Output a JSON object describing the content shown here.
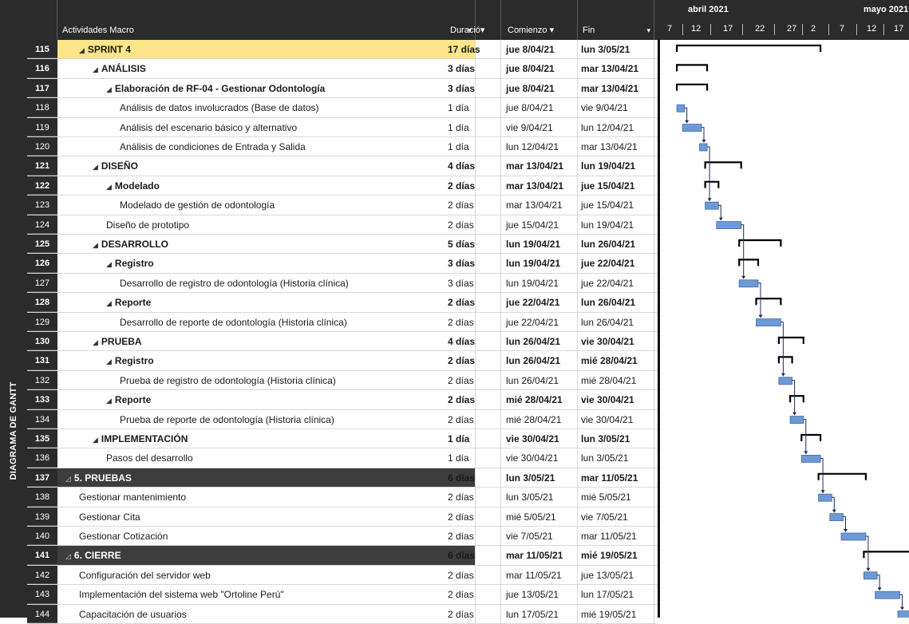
{
  "sidebar": {
    "label": "DIAGRAMA DE GANTT"
  },
  "header": {
    "columns": [
      {
        "label": "Actividades Macro"
      },
      {
        "label": "Duració▾"
      },
      {
        "label": "Comienzo ▾"
      },
      {
        "label": "Fin"
      }
    ],
    "dropdown_glyph": "▾"
  },
  "timescale": {
    "months": [
      "abril 2021",
      "mayo 2021"
    ],
    "days": [
      "7",
      "12",
      "17",
      "22",
      "27",
      "2",
      "7",
      "12",
      "17"
    ]
  },
  "rows": [
    {
      "id": "115",
      "name": "SPRINT 4",
      "dur": "17 días",
      "start": "jue 8/04/21",
      "end": "lun 3/05/21",
      "indent": 1,
      "summary": true,
      "bold": true,
      "selected": true
    },
    {
      "id": "116",
      "name": "ANÁLISIS",
      "dur": "3 días",
      "start": "jue 8/04/21",
      "end": "mar 13/04/21",
      "indent": 2,
      "summary": true,
      "bold": true
    },
    {
      "id": "117",
      "name": "Elaboración de RF-04 - Gestionar Odontología",
      "dur": "3 días",
      "start": "jue 8/04/21",
      "end": "mar 13/04/21",
      "indent": 3,
      "summary": true,
      "bold": true
    },
    {
      "id": "118",
      "name": "Análisis de datos involucrados (Base de datos)",
      "dur": "1 día",
      "start": "jue 8/04/21",
      "end": "vie 9/04/21",
      "indent": 4
    },
    {
      "id": "119",
      "name": "Análisis del escenario básico y alternativo",
      "dur": "1 día",
      "start": "vie 9/04/21",
      "end": "lun 12/04/21",
      "indent": 4
    },
    {
      "id": "120",
      "name": "Análisis de condiciones de Entrada y Salida",
      "dur": "1 día",
      "start": "lun 12/04/21",
      "end": "mar 13/04/21",
      "indent": 4
    },
    {
      "id": "121",
      "name": "DISEÑO",
      "dur": "4 días",
      "start": "mar 13/04/21",
      "end": "lun 19/04/21",
      "indent": 2,
      "summary": true,
      "bold": true
    },
    {
      "id": "122",
      "name": "Modelado",
      "dur": "2 días",
      "start": "mar 13/04/21",
      "end": "jue 15/04/21",
      "indent": 3,
      "summary": true,
      "bold": true
    },
    {
      "id": "123",
      "name": "Modelado de gestión de odontología",
      "dur": "2 días",
      "start": "mar 13/04/21",
      "end": "jue 15/04/21",
      "indent": 4
    },
    {
      "id": "124",
      "name": "Diseño de prototipo",
      "dur": "2 días",
      "start": "jue 15/04/21",
      "end": "lun 19/04/21",
      "indent": 3
    },
    {
      "id": "125",
      "name": "DESARROLLO",
      "dur": "5 días",
      "start": "lun 19/04/21",
      "end": "lun 26/04/21",
      "indent": 2,
      "summary": true,
      "bold": true
    },
    {
      "id": "126",
      "name": "Registro",
      "dur": "3 días",
      "start": "lun 19/04/21",
      "end": "jue 22/04/21",
      "indent": 3,
      "summary": true,
      "bold": true
    },
    {
      "id": "127",
      "name": "Desarrollo de registro de odontología (Historia clínica)",
      "dur": "3 días",
      "start": "lun 19/04/21",
      "end": "jue 22/04/21",
      "indent": 4
    },
    {
      "id": "128",
      "name": "Reporte",
      "dur": "2 días",
      "start": "jue 22/04/21",
      "end": "lun 26/04/21",
      "indent": 3,
      "summary": true,
      "bold": true
    },
    {
      "id": "129",
      "name": "Desarrollo de reporte de odontología (Historia clínica)",
      "dur": "2 días",
      "start": "jue 22/04/21",
      "end": "lun 26/04/21",
      "indent": 4
    },
    {
      "id": "130",
      "name": "PRUEBA",
      "dur": "4 días",
      "start": "lun 26/04/21",
      "end": "vie 30/04/21",
      "indent": 2,
      "summary": true,
      "bold": true
    },
    {
      "id": "131",
      "name": "Registro",
      "dur": "2 días",
      "start": "lun 26/04/21",
      "end": "mié 28/04/21",
      "indent": 3,
      "summary": true,
      "bold": true
    },
    {
      "id": "132",
      "name": "Prueba de registro de odontología (Historia clínica)",
      "dur": "2 días",
      "start": "lun 26/04/21",
      "end": "mié 28/04/21",
      "indent": 4
    },
    {
      "id": "133",
      "name": "Reporte",
      "dur": "2 días",
      "start": "mié 28/04/21",
      "end": "vie 30/04/21",
      "indent": 3,
      "summary": true,
      "bold": true
    },
    {
      "id": "134",
      "name": "Prueba de reporte de odontología (Historia clínica)",
      "dur": "2 días",
      "start": "mié 28/04/21",
      "end": "vie 30/04/21",
      "indent": 4
    },
    {
      "id": "135",
      "name": "IMPLEMENTACIÓN",
      "dur": "1 día",
      "start": "vie 30/04/21",
      "end": "lun 3/05/21",
      "indent": 2,
      "summary": true,
      "bold": true
    },
    {
      "id": "136",
      "name": "Pasos del desarrollo",
      "dur": "1 día",
      "start": "vie 30/04/21",
      "end": "lun 3/05/21",
      "indent": 3
    },
    {
      "id": "137",
      "name": "5. PRUEBAS",
      "dur": "6 días",
      "start": "lun 3/05/21",
      "end": "mar 11/05/21",
      "indent": 0,
      "summary": true,
      "bold": true,
      "dark": true
    },
    {
      "id": "138",
      "name": "Gestionar mantenimiento",
      "dur": "2 días",
      "start": "lun 3/05/21",
      "end": "mié 5/05/21",
      "indent": 1
    },
    {
      "id": "139",
      "name": "Gestionar Cita",
      "dur": "2 días",
      "start": "mié 5/05/21",
      "end": "vie 7/05/21",
      "indent": 1
    },
    {
      "id": "140",
      "name": "Gestionar Cotización",
      "dur": "2 días",
      "start": "vie 7/05/21",
      "end": "mar 11/05/21",
      "indent": 1
    },
    {
      "id": "141",
      "name": "6. CIERRE",
      "dur": "6 días",
      "start": "mar 11/05/21",
      "end": "mié 19/05/21",
      "indent": 0,
      "summary": true,
      "bold": true,
      "dark": true
    },
    {
      "id": "142",
      "name": "Configuración del servidor web",
      "dur": "2 días",
      "start": "mar 11/05/21",
      "end": "jue 13/05/21",
      "indent": 1
    },
    {
      "id": "143",
      "name": "Implementación del sistema web \"Ortoline Perú\"",
      "dur": "2 días",
      "start": "jue 13/05/21",
      "end": "lun 17/05/21",
      "indent": 1
    },
    {
      "id": "144",
      "name": "Capacitación de usuarios",
      "dur": "2 días",
      "start": "lun 17/05/21",
      "end": "mié 19/05/21",
      "indent": 1
    }
  ],
  "gantt": {
    "scale_origin": "2021-04-07",
    "bar_color": "#6e99d6",
    "bar_border": "#3d6aa8",
    "summary_color": "#000000",
    "arrow_color": "#1f2b57"
  }
}
